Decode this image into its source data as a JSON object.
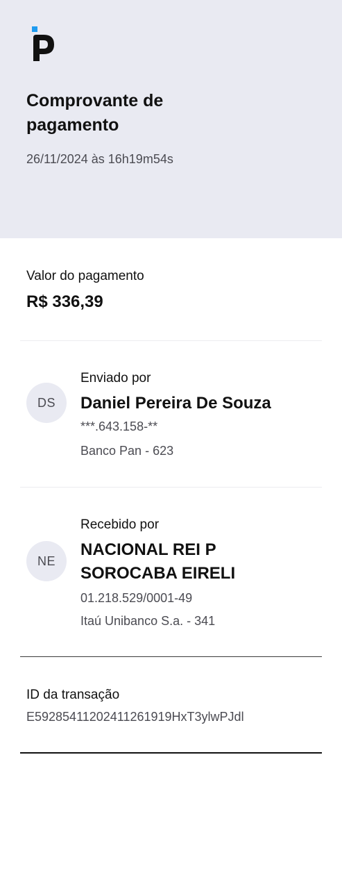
{
  "brand": {
    "logo_icon": "pan-logo-icon",
    "accent_color": "#1e9bf0",
    "logo_color": "#111111"
  },
  "header": {
    "title": "Comprovante de pagamento",
    "datetime": "26/11/2024 às 16h19m54s"
  },
  "payment": {
    "label": "Valor do pagamento",
    "amount": "R$ 336,39"
  },
  "sender": {
    "label": "Enviado por",
    "initials": "DS",
    "name": "Daniel Pereira De Souza",
    "document": "***.643.158-**",
    "bank": "Banco Pan - 623"
  },
  "receiver": {
    "label": "Recebido por",
    "initials": "NE",
    "name": "NACIONAL REI P SOROCABA EIRELI",
    "document": "01.218.529/0001-49",
    "bank": "Itaú Unibanco S.a. - 341"
  },
  "transaction": {
    "label": "ID da transação",
    "id": "E59285411202411261919HxT3ylwPJdl"
  },
  "colors": {
    "header_bg": "#e9eaf2",
    "avatar_bg": "#e9eaf2",
    "secondary_text": "#4b4b52"
  }
}
